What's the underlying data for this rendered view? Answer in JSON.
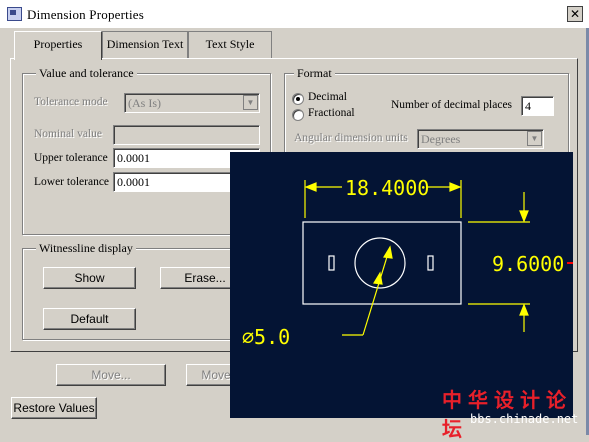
{
  "window": {
    "title": "Dimension Properties",
    "close_glyph": "✕"
  },
  "tabs": [
    {
      "label": "Properties",
      "active": true
    },
    {
      "label": "Dimension Text",
      "active": false
    },
    {
      "label": "Text Style",
      "active": false
    }
  ],
  "value_tolerance": {
    "group_label": "Value and tolerance",
    "tolerance_mode_label": "Tolerance mode",
    "tolerance_mode_value": "(As Is)",
    "nominal_value_label": "Nominal value",
    "nominal_value": "",
    "upper_tolerance_label": "Upper tolerance",
    "upper_tolerance_value": "0.0001",
    "lower_tolerance_label": "Lower tolerance",
    "lower_tolerance_value": "0.0001"
  },
  "format": {
    "group_label": "Format",
    "decimal_label": "Decimal",
    "fractional_label": "Fractional",
    "selected": "Decimal",
    "decimal_places_label": "Number of decimal places",
    "decimal_places_value": "4",
    "angular_units_label": "Angular dimension units",
    "angular_units_value": "Degrees"
  },
  "witnessline": {
    "group_label": "Witnessline display",
    "show_label": "Show",
    "erase_label": "Erase...",
    "default_label": "Default"
  },
  "bottom": {
    "move_label": "Move...",
    "move2_label": "Move",
    "restore_label": "Restore Values"
  },
  "cad_overlay": {
    "width_dim": "18.4000",
    "height_dim": "9.6000",
    "diameter_dim": "∅5.0",
    "line_color": "#ffff00",
    "background": "#041434"
  },
  "watermark": {
    "text_cn": "中华设计论坛",
    "url": "bbs.chinade.net"
  }
}
